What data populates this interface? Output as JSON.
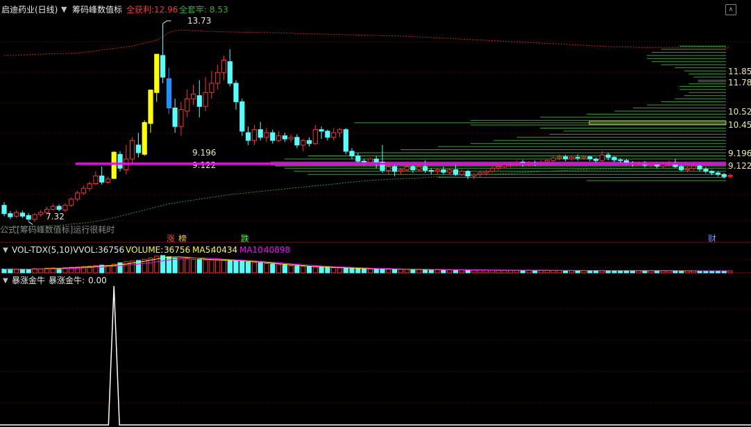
{
  "header": {
    "stock_title": "启迪药业(日线)",
    "indicator_name": "筹码峰数值标",
    "profit_label": "全获利:",
    "profit_value": "12.96",
    "trapped_label": "全套牢:",
    "trapped_value": "8.53"
  },
  "main_panel": {
    "formula_note": "公式[筹码峰数值标]运行很耗时",
    "high_marker": "13.73",
    "low_marker": "7.32",
    "peak_line_labels": [
      "9.196",
      "9.122"
    ],
    "right_price_labels": [
      "11.85",
      "11.78",
      "10.52",
      "10.45",
      "9.196",
      "9.122"
    ],
    "badges": [
      {
        "text": "涨",
        "color": "#ff4040"
      },
      {
        "text": "榜",
        "color": "#ffcc00"
      },
      {
        "text": "跌",
        "color": "#33ff33"
      },
      {
        "text": "财",
        "color": "#6699ff"
      }
    ]
  },
  "volume_panel": {
    "name": "VOL-TDX(5,10)",
    "vvol_label": "VVOL:",
    "vvol_value": "36756",
    "volume_label": "VOLUME:",
    "volume_value": "36756",
    "ma5_label": "MA5:",
    "ma5_value": "40434",
    "ma10_label": "MA10:",
    "ma10_value": "40898"
  },
  "signal_panel": {
    "name": "暴涨金牛",
    "series_label": "暴涨金牛:",
    "series_value": "0.00"
  },
  "colors": {
    "up": "#ff3232",
    "down": "#54ffff",
    "peak_line": "#ff00ff",
    "chip_lines": "#3ca03c",
    "limit_up": "#ffff00",
    "limit_down": "#00cc00",
    "ma5": "#ffff00",
    "ma10": "#ff00ff"
  },
  "chart_data": {
    "type": "candlestick",
    "ylim": [
      6.9,
      14.0
    ],
    "max_high": 13.73,
    "min_low": 7.32,
    "chip_peak_prices": [
      9.196,
      9.122
    ],
    "signal_spike_index": 18,
    "candles": [
      [
        7.85,
        7.58,
        7.95,
        7.5
      ],
      [
        7.58,
        7.48,
        7.66,
        7.4
      ],
      [
        7.5,
        7.62,
        7.7,
        7.44
      ],
      [
        7.6,
        7.5,
        7.68,
        7.44
      ],
      [
        7.52,
        7.4,
        7.6,
        7.34
      ],
      [
        7.4,
        7.55,
        7.6,
        7.32
      ],
      [
        7.55,
        7.62,
        7.7,
        7.48
      ],
      [
        7.62,
        7.72,
        7.8,
        7.55
      ],
      [
        7.72,
        7.82,
        7.9,
        7.68
      ],
      [
        7.82,
        7.72,
        7.88,
        7.66
      ],
      [
        7.7,
        7.85,
        7.92,
        7.64
      ],
      [
        7.85,
        8.05,
        8.1,
        7.8
      ],
      [
        8.05,
        8.25,
        8.32,
        7.98
      ],
      [
        8.25,
        8.4,
        8.5,
        8.18
      ],
      [
        8.4,
        8.55,
        8.62,
        8.3
      ],
      [
        8.55,
        8.8,
        8.95,
        8.5
      ],
      [
        8.8,
        8.6,
        9.1,
        8.52
      ],
      [
        8.6,
        8.7,
        8.78,
        8.55
      ],
      [
        8.72,
        9.57,
        9.6,
        8.7
      ],
      [
        9.5,
        9.05,
        9.6,
        8.95
      ],
      [
        9.0,
        9.35,
        9.8,
        8.85
      ],
      [
        9.35,
        9.95,
        10.05,
        9.2
      ],
      [
        9.8,
        9.55,
        10.2,
        9.4
      ],
      [
        9.5,
        10.53,
        10.6,
        9.45
      ],
      [
        10.5,
        11.58,
        11.6,
        10.2
      ],
      [
        11.5,
        12.74,
        12.75,
        11.2
      ],
      [
        12.7,
        12.0,
        13.73,
        11.8
      ],
      [
        11.95,
        11.0,
        12.3,
        10.8
      ],
      [
        11.0,
        10.4,
        11.3,
        10.2
      ],
      [
        10.4,
        10.95,
        11.2,
        10.1
      ],
      [
        10.9,
        11.3,
        11.6,
        10.7
      ],
      [
        11.3,
        11.45,
        11.75,
        11.1
      ],
      [
        11.4,
        11.05,
        11.9,
        10.7
      ],
      [
        11.05,
        11.5,
        12.0,
        10.9
      ],
      [
        11.5,
        11.8,
        12.2,
        11.3
      ],
      [
        11.8,
        12.15,
        12.4,
        11.6
      ],
      [
        12.15,
        12.55,
        12.7,
        11.9
      ],
      [
        12.5,
        11.8,
        12.9,
        11.7
      ],
      [
        11.8,
        11.2,
        11.9,
        10.95
      ],
      [
        11.2,
        10.25,
        11.3,
        10.1
      ],
      [
        10.2,
        9.95,
        10.4,
        9.8
      ],
      [
        9.95,
        10.3,
        10.45,
        9.8
      ],
      [
        10.3,
        10.05,
        10.55,
        9.95
      ],
      [
        10.05,
        10.2,
        10.35,
        9.9
      ],
      [
        10.2,
        9.95,
        10.3,
        9.85
      ],
      [
        9.95,
        10.1,
        10.25,
        9.9
      ],
      [
        10.1,
        10.0,
        10.2,
        9.9
      ],
      [
        10.0,
        10.05,
        10.15,
        9.9
      ],
      [
        10.05,
        9.8,
        10.15,
        9.7
      ],
      [
        9.8,
        9.95,
        10.0,
        9.6
      ],
      [
        9.95,
        9.85,
        10.05,
        9.75
      ],
      [
        9.85,
        10.3,
        10.45,
        9.8
      ],
      [
        10.3,
        10.25,
        10.4,
        10.0
      ],
      [
        10.25,
        10.05,
        10.3,
        9.95
      ],
      [
        10.05,
        10.2,
        10.35,
        9.95
      ],
      [
        10.2,
        10.3,
        10.35,
        10.05
      ],
      [
        10.3,
        9.6,
        10.35,
        9.5
      ],
      [
        9.6,
        9.45,
        9.7,
        9.35
      ],
      [
        9.45,
        9.28,
        9.55,
        9.2
      ],
      [
        9.28,
        9.25,
        9.35,
        9.15
      ],
      [
        9.25,
        9.35,
        9.4,
        9.1
      ],
      [
        9.35,
        9.25,
        9.45,
        9.05
      ],
      [
        9.25,
        8.98,
        9.8,
        8.9
      ],
      [
        8.98,
        9.1,
        9.2,
        8.85
      ],
      [
        9.1,
        8.95,
        9.15,
        8.8
      ],
      [
        8.95,
        9.0,
        9.05,
        8.85
      ],
      [
        9.0,
        9.1,
        9.2,
        8.95
      ],
      [
        9.1,
        9.0,
        9.15,
        8.9
      ],
      [
        9.0,
        9.1,
        9.2,
        8.95
      ],
      [
        9.1,
        8.98,
        9.3,
        8.9
      ],
      [
        8.98,
        8.95,
        9.05,
        8.85
      ],
      [
        8.95,
        9.0,
        9.05,
        8.85
      ],
      [
        9.0,
        8.92,
        9.1,
        8.85
      ],
      [
        8.92,
        9.0,
        9.05,
        8.85
      ],
      [
        9.0,
        8.85,
        9.15,
        8.8
      ],
      [
        8.85,
        8.95,
        9.0,
        8.8
      ],
      [
        8.95,
        8.8,
        9.0,
        8.7
      ],
      [
        8.8,
        8.85,
        8.9,
        8.7
      ],
      [
        8.85,
        8.9,
        8.95,
        8.75
      ],
      [
        8.9,
        8.95,
        9.0,
        8.82
      ],
      [
        8.95,
        9.05,
        9.1,
        8.9
      ],
      [
        9.05,
        9.1,
        9.15,
        8.98
      ],
      [
        9.1,
        9.15,
        9.2,
        9.05
      ],
      [
        9.15,
        9.2,
        9.25,
        9.08
      ],
      [
        9.2,
        9.25,
        9.3,
        9.12
      ],
      [
        9.25,
        9.18,
        9.32,
        9.1
      ],
      [
        9.18,
        9.22,
        9.28,
        9.1
      ],
      [
        9.22,
        9.2,
        9.3,
        9.12
      ],
      [
        9.2,
        9.25,
        9.3,
        9.15
      ],
      [
        9.25,
        9.3,
        9.35,
        9.18
      ],
      [
        9.3,
        9.38,
        9.45,
        9.25
      ],
      [
        9.38,
        9.42,
        9.5,
        9.3
      ],
      [
        9.42,
        9.35,
        9.48,
        9.28
      ],
      [
        9.35,
        9.4,
        9.45,
        9.3
      ],
      [
        9.4,
        9.38,
        9.5,
        9.3
      ],
      [
        9.38,
        9.42,
        9.48,
        9.32
      ],
      [
        9.42,
        9.35,
        9.45,
        9.28
      ],
      [
        9.35,
        9.3,
        9.4,
        9.22
      ],
      [
        9.3,
        9.48,
        9.6,
        9.25
      ],
      [
        9.48,
        9.4,
        9.55,
        9.3
      ],
      [
        9.4,
        9.32,
        9.45,
        9.25
      ],
      [
        9.32,
        9.3,
        9.38,
        9.22
      ],
      [
        9.3,
        9.22,
        9.35,
        9.15
      ],
      [
        9.22,
        9.18,
        9.28,
        9.1
      ],
      [
        9.18,
        9.22,
        9.26,
        9.12
      ],
      [
        9.22,
        9.15,
        9.28,
        9.08
      ],
      [
        9.15,
        9.18,
        9.22,
        9.08
      ],
      [
        9.18,
        9.12,
        9.24,
        9.05
      ],
      [
        9.12,
        9.18,
        9.25,
        9.05
      ],
      [
        9.18,
        9.22,
        9.3,
        9.12
      ],
      [
        9.22,
        9.1,
        9.35,
        9.05
      ],
      [
        9.1,
        9.0,
        9.15,
        8.95
      ],
      [
        9.0,
        9.05,
        9.1,
        8.92
      ],
      [
        9.05,
        9.12,
        9.18,
        8.98
      ],
      [
        9.12,
        9.02,
        9.18,
        8.95
      ],
      [
        9.02,
        8.95,
        9.08,
        8.88
      ],
      [
        8.95,
        8.9,
        9.0,
        8.82
      ],
      [
        8.9,
        8.85,
        8.95,
        8.78
      ],
      [
        8.85,
        8.78,
        8.9,
        8.72
      ],
      [
        8.78,
        8.82,
        8.88,
        8.72
      ]
    ],
    "volume": [
      30,
      32,
      28,
      30,
      27,
      35,
      33,
      38,
      40,
      37,
      42,
      45,
      48,
      52,
      55,
      58,
      62,
      60,
      70,
      82,
      90,
      95,
      100,
      110,
      120,
      135,
      140,
      130,
      120,
      115,
      112,
      110,
      108,
      106,
      105,
      103,
      100,
      98,
      95,
      92,
      88,
      84,
      80,
      76,
      72,
      68,
      64,
      60,
      56,
      52,
      50,
      48,
      46,
      44,
      42,
      40,
      38,
      36,
      34,
      33,
      32,
      31,
      30,
      30,
      29,
      29,
      28,
      28,
      27,
      27,
      26,
      26,
      25,
      25,
      24,
      24,
      23,
      23,
      22,
      22,
      22,
      21,
      21,
      21,
      20,
      20,
      20,
      20,
      20,
      20,
      19,
      19,
      19,
      19,
      19,
      19,
      19,
      19,
      18,
      18,
      18,
      18,
      18,
      18,
      18,
      18,
      18,
      18,
      18,
      18,
      17,
      17,
      17,
      17,
      17,
      17,
      17,
      17,
      17,
      17
    ],
    "ma5": [
      30,
      30,
      30,
      30,
      29,
      30,
      31,
      33,
      35,
      37,
      38,
      40,
      42,
      45,
      48,
      52,
      55,
      57,
      60,
      66,
      72,
      79,
      87,
      94,
      103,
      112,
      121,
      127,
      129,
      128,
      125,
      121,
      117,
      111,
      108,
      106,
      104,
      102,
      100,
      97,
      94,
      91,
      87,
      83,
      79,
      74,
      70,
      66,
      62,
      58,
      54,
      51,
      49,
      47,
      45,
      43,
      41,
      39,
      37,
      35,
      34,
      33,
      32,
      31,
      30,
      30,
      29,
      29,
      28,
      28,
      27,
      27,
      26,
      26,
      25,
      25,
      24,
      24,
      23,
      23,
      22,
      22,
      22,
      21,
      21,
      21,
      20,
      20,
      20,
      20,
      20,
      20,
      19,
      19,
      19,
      19,
      19,
      19,
      19,
      19,
      18,
      18,
      18,
      18,
      18,
      18,
      18,
      18,
      18,
      18,
      18,
      17,
      17,
      17,
      17,
      17,
      17,
      17,
      17,
      17
    ],
    "ma10": [
      30,
      30,
      30,
      30,
      30,
      30,
      30,
      31,
      32,
      33,
      34,
      36,
      38,
      40,
      42,
      45,
      48,
      51,
      54,
      58,
      62,
      66,
      71,
      77,
      83,
      90,
      97,
      104,
      110,
      115,
      118,
      120,
      120,
      119,
      117,
      114,
      111,
      108,
      105,
      102,
      99,
      96,
      93,
      89,
      85,
      82,
      78,
      74,
      70,
      66,
      62,
      59,
      56,
      53,
      50,
      48,
      46,
      44,
      42,
      40,
      38,
      36,
      35,
      34,
      33,
      32,
      31,
      30,
      30,
      29,
      28,
      28,
      27,
      27,
      26,
      26,
      25,
      25,
      24,
      24,
      23,
      23,
      23,
      22,
      22,
      22,
      21,
      21,
      21,
      21,
      20,
      20,
      20,
      20,
      20,
      20,
      19,
      19,
      19,
      19,
      19,
      19,
      19,
      18,
      18,
      18,
      18,
      18,
      18,
      18,
      18,
      18,
      18,
      18,
      17,
      17,
      17,
      17,
      17,
      17
    ],
    "long_ma": [
      7.15,
      7.15,
      7.15,
      7.15,
      7.15,
      7.16,
      7.17,
      7.18,
      7.19,
      7.2,
      7.22,
      7.24,
      7.26,
      7.28,
      7.3,
      7.33,
      7.36,
      7.4,
      7.45,
      7.5,
      7.55,
      7.6,
      7.65,
      7.7,
      7.75,
      7.8,
      7.85,
      7.9,
      7.93,
      7.96,
      7.99,
      8.02,
      8.05,
      8.08,
      8.11,
      8.14,
      8.17,
      8.2,
      8.22,
      8.24,
      8.26,
      8.28,
      8.3,
      8.32,
      8.34,
      8.36,
      8.38,
      8.4,
      8.42,
      8.44,
      8.46,
      8.48,
      8.5,
      8.52,
      8.54,
      8.56,
      8.58,
      8.6,
      8.62,
      8.64,
      8.66,
      8.67,
      8.68,
      8.69,
      8.7,
      8.71,
      8.72,
      8.73,
      8.74,
      8.75,
      8.76,
      8.77,
      8.78,
      8.79,
      8.8,
      8.81,
      8.82,
      8.83,
      8.84,
      8.85,
      8.86,
      8.87,
      8.88,
      8.89,
      8.9,
      8.91,
      8.92,
      8.93,
      8.94,
      8.95,
      8.96,
      8.97,
      8.98,
      8.99,
      9.0,
      9.0,
      9.01,
      9.01,
      9.02,
      9.02,
      9.03,
      9.03,
      9.03,
      9.04,
      9.04,
      9.04,
      9.05,
      9.05,
      9.05,
      9.05,
      9.05,
      9.05,
      9.05,
      9.05,
      9.05,
      9.05,
      9.05,
      9.05,
      9.05,
      9.05
    ],
    "cost_line": [
      12.7,
      12.7,
      12.7,
      12.72,
      12.72,
      12.74,
      12.74,
      12.75,
      12.75,
      12.76,
      12.76,
      12.77,
      12.78,
      12.8,
      12.82,
      12.85,
      12.88,
      12.9,
      12.92,
      12.95,
      12.98,
      13.0,
      13.05,
      13.1,
      13.15,
      13.2,
      13.3,
      13.45,
      13.5,
      13.52,
      13.52,
      13.5,
      13.5,
      13.48,
      13.48,
      13.47,
      13.47,
      13.46,
      13.46,
      13.45,
      13.45,
      13.45,
      13.44,
      13.44,
      13.43,
      13.43,
      13.42,
      13.42,
      13.41,
      13.41,
      13.4,
      13.4,
      13.39,
      13.39,
      13.38,
      13.38,
      13.37,
      13.37,
      13.36,
      13.36,
      13.35,
      13.35,
      13.34,
      13.34,
      13.33,
      13.33,
      13.32,
      13.31,
      13.3,
      13.29,
      13.28,
      13.27,
      13.26,
      13.25,
      13.24,
      13.23,
      13.22,
      13.21,
      13.2,
      13.19,
      13.18,
      13.17,
      13.16,
      13.15,
      13.14,
      13.13,
      13.12,
      13.11,
      13.1,
      13.09,
      13.08,
      13.07,
      13.06,
      13.05,
      13.04,
      13.03,
      13.02,
      13.01,
      13.0,
      12.99,
      12.98,
      12.98,
      12.97,
      12.97,
      12.96,
      12.96,
      12.96,
      12.96,
      12.96,
      12.96,
      12.96,
      12.96,
      12.96,
      12.96,
      12.96,
      12.96,
      12.96,
      12.96,
      12.96,
      12.96
    ],
    "chip_profile": [
      [
        13.0,
        0.1
      ],
      [
        12.9,
        0.14
      ],
      [
        12.8,
        0.16
      ],
      [
        12.7,
        0.17
      ],
      [
        12.6,
        0.17
      ],
      [
        12.5,
        0.16
      ],
      [
        12.4,
        0.14
      ],
      [
        12.3,
        0.11
      ],
      [
        12.2,
        0.09
      ],
      [
        12.1,
        0.08
      ],
      [
        12.0,
        0.07
      ],
      [
        11.9,
        0.06
      ],
      [
        11.85,
        0.06
      ],
      [
        11.78,
        0.08
      ],
      [
        11.7,
        0.1
      ],
      [
        11.6,
        0.1
      ],
      [
        11.5,
        0.08
      ],
      [
        11.4,
        0.09
      ],
      [
        11.3,
        0.11
      ],
      [
        11.2,
        0.14
      ],
      [
        11.1,
        0.17
      ],
      [
        11.0,
        0.2
      ],
      [
        10.9,
        0.24
      ],
      [
        10.8,
        0.3
      ],
      [
        10.7,
        0.4
      ],
      [
        10.6,
        0.55
      ],
      [
        10.52,
        0.8
      ],
      [
        10.45,
        0.55
      ],
      [
        10.35,
        0.4
      ],
      [
        10.25,
        0.35
      ],
      [
        10.15,
        0.38
      ],
      [
        10.05,
        0.45
      ],
      [
        9.95,
        0.5
      ],
      [
        9.85,
        0.55
      ],
      [
        9.75,
        0.62
      ],
      [
        9.65,
        0.7
      ],
      [
        9.55,
        0.8
      ],
      [
        9.45,
        0.9
      ],
      [
        9.35,
        0.95
      ],
      [
        9.25,
        0.98
      ],
      [
        9.196,
        1.0
      ],
      [
        9.15,
        0.98
      ],
      [
        9.122,
        0.97
      ],
      [
        9.05,
        0.95
      ],
      [
        8.95,
        0.93
      ],
      [
        8.85,
        0.9
      ],
      [
        8.75,
        0.62
      ],
      [
        8.65,
        0.3
      ]
    ]
  }
}
